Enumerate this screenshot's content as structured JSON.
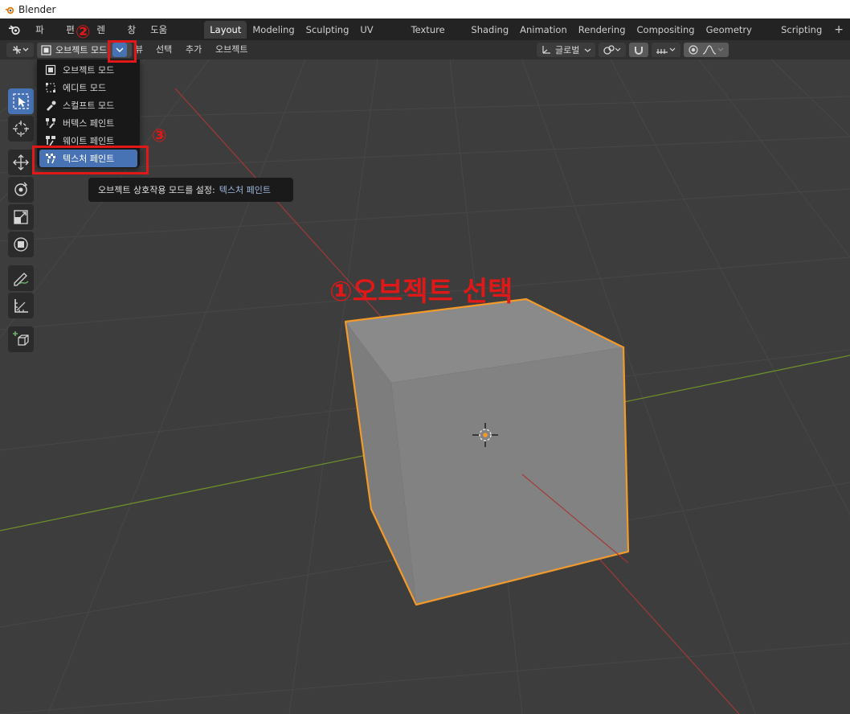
{
  "window": {
    "title": "Blender"
  },
  "menu": {
    "items": [
      "파일",
      "편집",
      "렌더",
      "창",
      "도움말"
    ]
  },
  "workspaces": [
    "Layout",
    "Modeling",
    "Sculpting",
    "UV Editing",
    "Texture Paint",
    "Shading",
    "Animation",
    "Rendering",
    "Compositing",
    "Geometry Nodes",
    "Scripting"
  ],
  "active_workspace": "Layout",
  "add_workspace": "+",
  "viewport_header": {
    "mode_value": "오브젝트 모드",
    "menus": [
      "뷰",
      "선택",
      "추가",
      "오브젝트"
    ],
    "orientation": "글로벌"
  },
  "mode_dropdown": {
    "items": [
      "오브젝트 모드",
      "에디트 모드",
      "스컬프트 모드",
      "버텍스 페인트",
      "웨이트 페인트",
      "텍스처 페인트"
    ],
    "selected_index": 5
  },
  "tooltip": {
    "text": "오브젝트 상호작용 모드를 설정:",
    "value": "텍스처 페인트"
  },
  "annotations": {
    "step1": "①오브젝트 선택",
    "step2": "②",
    "step3": "③"
  },
  "colors": {
    "accent": "#4772b3",
    "annotation": "#e01818",
    "selection_outline": "#f39a2a",
    "x_axis": "#b33a3a",
    "y_axis": "#6c8e2b"
  }
}
